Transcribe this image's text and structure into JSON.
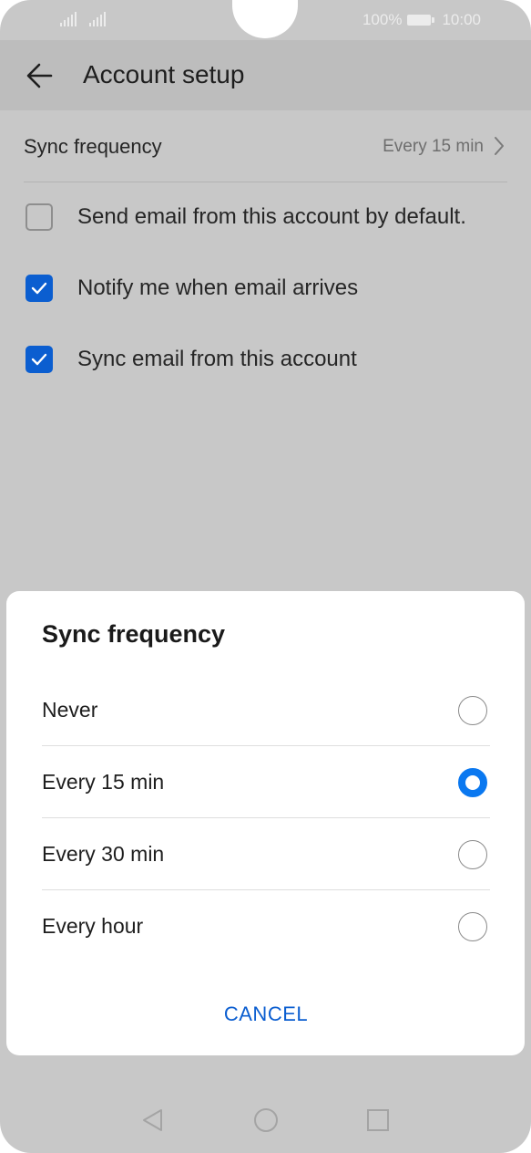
{
  "status_bar": {
    "battery": "100%",
    "time": "10:00"
  },
  "app_bar": {
    "title": "Account setup"
  },
  "settings": {
    "sync_label": "Sync frequency",
    "sync_value": "Every 15 min",
    "checkboxes": [
      {
        "label": "Send email from this account by default.",
        "checked": false
      },
      {
        "label": "Notify me when email arrives",
        "checked": true
      },
      {
        "label": "Sync email from this account",
        "checked": true
      }
    ]
  },
  "dialog": {
    "title": "Sync frequency",
    "options": [
      {
        "label": "Never",
        "selected": false
      },
      {
        "label": "Every 15 min",
        "selected": true
      },
      {
        "label": "Every 30 min",
        "selected": false
      },
      {
        "label": "Every hour",
        "selected": false
      }
    ],
    "cancel_label": "CANCEL"
  },
  "colors": {
    "accent": "#0a78f0",
    "checkbox_on": "#0b5ed0",
    "scrim": "#c8c8c8"
  },
  "icons": {
    "back": "arrow-left-icon",
    "chevron": "chevron-right-icon",
    "nav_back": "triangle-back-icon",
    "nav_home": "circle-home-icon",
    "nav_recent": "square-recent-icon"
  }
}
